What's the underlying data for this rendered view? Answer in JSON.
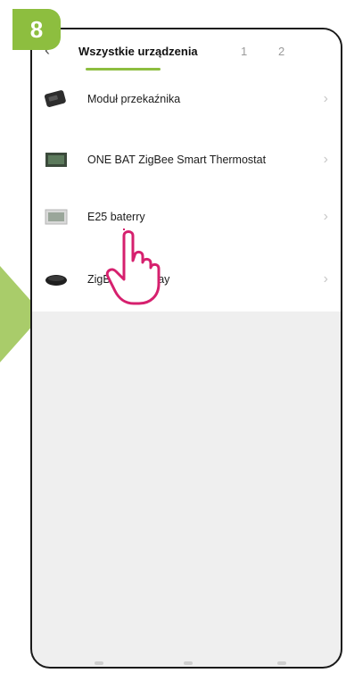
{
  "step_badge": "8",
  "header": {
    "tabs": [
      {
        "label": "Wszystkie urządzenia",
        "active": true
      },
      {
        "label": "1",
        "active": false
      },
      {
        "label": "2",
        "active": false
      }
    ],
    "accent_color": "#8dbe3f"
  },
  "devices": [
    {
      "label": "Moduł przekaźnika",
      "icon": "relay-module-icon"
    },
    {
      "label": "ONE BAT ZigBee Smart Thermostat",
      "icon": "thermostat-icon"
    },
    {
      "label": "E25 baterry",
      "icon": "thermostat-icon"
    },
    {
      "label": "ZigBee Gateway",
      "icon": "gateway-icon"
    }
  ],
  "annotation_color": "#d6206e"
}
